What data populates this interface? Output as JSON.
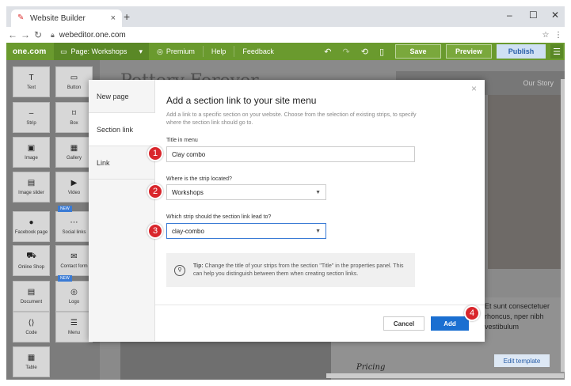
{
  "browser": {
    "tab_title": "Website Builder",
    "url": "webeditor.one.com",
    "new_tab": "+",
    "minimize": "–",
    "maximize": "☐",
    "close": "✕"
  },
  "toolbar": {
    "logo": "one.com",
    "page_selector": "Page: Workshops",
    "premium": "Premium",
    "help": "Help",
    "feedback": "Feedback",
    "save": "Save",
    "preview": "Preview",
    "publish": "Publish",
    "accent_color": "#6a9a2e"
  },
  "sidebar": {
    "widgets": [
      {
        "label": "Text",
        "icon": "T"
      },
      {
        "label": "Button",
        "icon": "▭"
      },
      {
        "label": "Strip",
        "icon": "–"
      },
      {
        "label": "Box",
        "icon": "⌑"
      },
      {
        "label": "Image",
        "icon": "▣"
      },
      {
        "label": "Gallery",
        "icon": "▦"
      },
      {
        "label": "Image slider",
        "icon": "▤"
      },
      {
        "label": "Video",
        "icon": "▶"
      },
      {
        "label": "Facebook page",
        "icon": "●"
      },
      {
        "label": "Social links",
        "icon": "⋯",
        "badge": "NEW"
      },
      {
        "label": "Online Shop",
        "icon": "⛟"
      },
      {
        "label": "Contact form",
        "icon": "✉"
      },
      {
        "label": "Document",
        "icon": "▤"
      },
      {
        "label": "Logo",
        "icon": "◎",
        "badge": "NEW"
      },
      {
        "label": "Code",
        "icon": "⟨⟩"
      },
      {
        "label": "Menu",
        "icon": "☰"
      },
      {
        "label": "Table",
        "icon": "▦"
      }
    ]
  },
  "site": {
    "title": "Pottery Forever",
    "nav_item": "Our Story",
    "body_text": "Et sunt consectetuer rhoncus, nper nibh vestibulum",
    "pricing": "Pricing",
    "edit_template": "Edit template"
  },
  "modal": {
    "nav": [
      "New page",
      "Section link",
      "Link"
    ],
    "active_nav": "Section link",
    "title": "Add a section link to your site menu",
    "description": "Add a link to a specific section on your website. Choose from the selection of existing strips, to specify where the section link should go to.",
    "field1_label": "Title in menu",
    "field1_value": "Clay combo",
    "field2_label": "Where is the strip located?",
    "field2_value": "Workshops",
    "field3_label": "Which strip should the section link lead to?",
    "field3_value": "clay-combo",
    "tip_bold": "Tip:",
    "tip_text": "Change the title of your strips from the section \"Title\" in the properties panel. This can help you distinguish between them when creating section links.",
    "cancel": "Cancel",
    "add": "Add",
    "close": "×"
  },
  "steps": [
    "1",
    "2",
    "3",
    "4"
  ]
}
